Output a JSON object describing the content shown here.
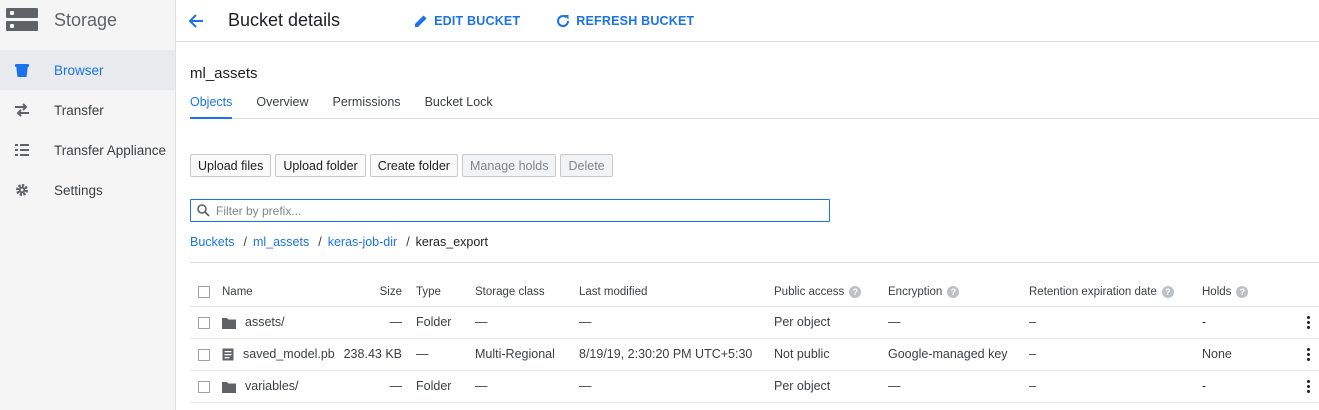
{
  "sidebar": {
    "title": "Storage",
    "items": [
      {
        "label": "Browser",
        "icon": "bucket-icon",
        "active": true
      },
      {
        "label": "Transfer",
        "icon": "transfer-arrows-icon"
      },
      {
        "label": "Transfer Appliance",
        "icon": "list-icon"
      },
      {
        "label": "Settings",
        "icon": "gear-icon"
      }
    ]
  },
  "topbar": {
    "title": "Bucket details",
    "edit_label": "EDIT BUCKET",
    "refresh_label": "REFRESH BUCKET"
  },
  "bucket": {
    "name": "ml_assets"
  },
  "tabs": [
    {
      "label": "Objects",
      "active": true
    },
    {
      "label": "Overview"
    },
    {
      "label": "Permissions"
    },
    {
      "label": "Bucket Lock"
    }
  ],
  "actions": {
    "upload_files": "Upload files",
    "upload_folder": "Upload folder",
    "create_folder": "Create folder",
    "manage_holds": "Manage holds",
    "delete": "Delete"
  },
  "filter": {
    "placeholder": "Filter by prefix..."
  },
  "breadcrumb": [
    "Buckets",
    "ml_assets",
    "keras-job-dir",
    "keras_export"
  ],
  "table": {
    "columns": {
      "name": "Name",
      "size": "Size",
      "type": "Type",
      "storage_class": "Storage class",
      "last_modified": "Last modified",
      "public_access": "Public access",
      "encryption": "Encryption",
      "retention": "Retention expiration date",
      "holds": "Holds"
    },
    "rows": [
      {
        "name": "assets/",
        "icon": "folder-icon",
        "size": "—",
        "type": "Folder",
        "storage_class": "—",
        "last_modified": "—",
        "public_access": "Per object",
        "encryption": "—",
        "retention": "–",
        "holds": "-"
      },
      {
        "name": "saved_model.pb",
        "icon": "file-icon",
        "size": "238.43 KB",
        "type": "—",
        "storage_class": "Multi-Regional",
        "last_modified": "8/19/19, 2:30:20 PM UTC+5:30",
        "public_access": "Not public",
        "encryption": "Google-managed key",
        "retention": "–",
        "holds": "None"
      },
      {
        "name": "variables/",
        "icon": "folder-icon",
        "size": "—",
        "type": "Folder",
        "storage_class": "—",
        "last_modified": "—",
        "public_access": "Per object",
        "encryption": "—",
        "retention": "–",
        "holds": "-"
      }
    ]
  },
  "colors": {
    "accent": "#1a73e8",
    "sidebar_bg": "#f5f5f5",
    "icon_gray": "#5f6368"
  }
}
